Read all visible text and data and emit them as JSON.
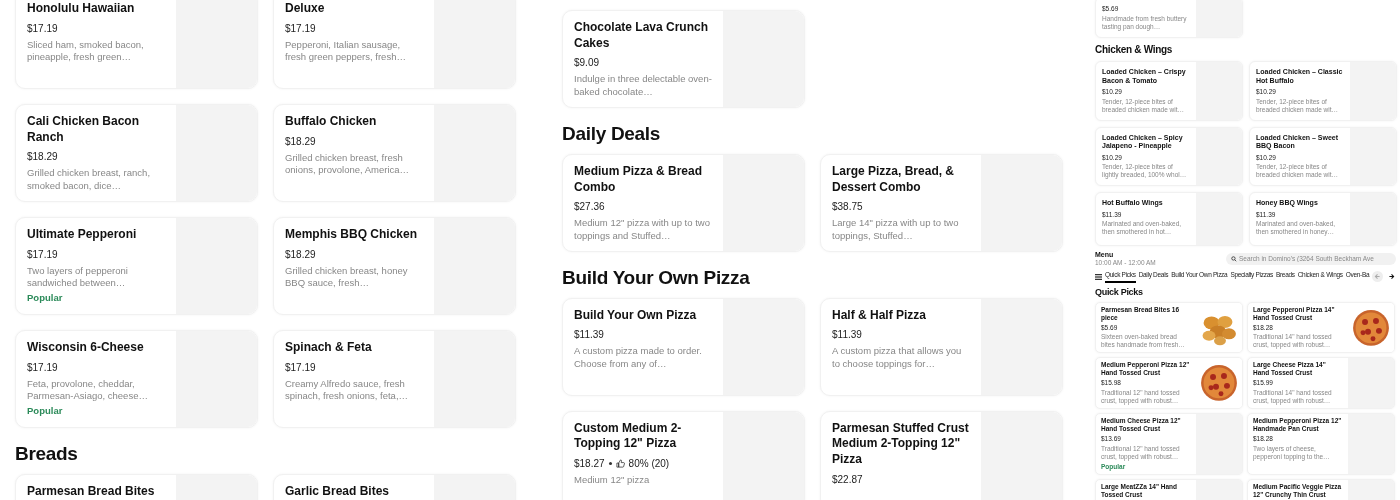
{
  "screens": [
    {
      "blocks": [
        {
          "kind": "cards",
          "cards": [
            {
              "name": "Honolulu Hawaiian",
              "price": "$17.19",
              "description": "Sliced ham, smoked bacon, pineapple, fresh green…",
              "photo": false
            },
            {
              "name": "Deluxe",
              "price": "$17.19",
              "description": "Pepperoni, Italian sausage, fresh green peppers, fresh…",
              "photo": false
            },
            {
              "name": "Cali Chicken Bacon Ranch",
              "price": "$18.29",
              "description": "Grilled chicken breast, ranch, smoked bacon, dice…",
              "photo": false
            },
            {
              "name": "Buffalo Chicken",
              "price": "$18.29",
              "description": "Grilled chicken breast, fresh onions, provolone, America…",
              "photo": false
            },
            {
              "name": "Ultimate Pepperoni",
              "price": "$17.19",
              "description": "Two layers of pepperoni sandwiched between…",
              "badge": "Popular",
              "photo": false
            },
            {
              "name": "Memphis BBQ Chicken",
              "price": "$18.29",
              "description": "Grilled chicken breast, honey BBQ sauce, fresh…",
              "photo": false
            },
            {
              "name": "Wisconsin 6-Cheese",
              "price": "$17.19",
              "description": "Feta, provolone, cheddar, Parmesan-Asiago, cheese…",
              "badge": "Popular",
              "photo": false
            },
            {
              "name": "Spinach & Feta",
              "price": "$17.19",
              "description": "Creamy Alfredo sauce, fresh spinach, fresh onions, feta,…",
              "photo": false
            }
          ]
        },
        {
          "kind": "heading",
          "text": "Breads"
        },
        {
          "kind": "cards",
          "cards": [
            {
              "name": "Parmesan Bread Bites",
              "photo": false
            },
            {
              "name": "Garlic Bread Bites",
              "photo": false
            }
          ]
        }
      ]
    },
    {
      "blocks": [
        {
          "kind": "cards",
          "cards": [
            {
              "name": "Chocolate Lava Crunch Cakes",
              "price": "$9.09",
              "description": "Indulge in three delectable oven-baked chocolate…",
              "photo": false
            }
          ]
        },
        {
          "kind": "heading",
          "text": "Daily Deals"
        },
        {
          "kind": "cards",
          "cards": [
            {
              "name": "Medium Pizza & Bread Combo",
              "price": "$27.36",
              "description": "Medium 12\" pizza with up to two toppings and Stuffed…",
              "photo": false
            },
            {
              "name": "Large Pizza, Bread, & Dessert Combo",
              "price": "$38.75",
              "description": "Large 14\" pizza with up to two toppings, Stuffed…",
              "photo": false
            }
          ]
        },
        {
          "kind": "heading",
          "text": "Build Your Own Pizza"
        },
        {
          "kind": "cards",
          "cards": [
            {
              "name": "Build Your Own Pizza",
              "price": "$11.39",
              "description": "A custom pizza made to order. Choose from any of…",
              "photo": false
            },
            {
              "name": "Half & Half Pizza",
              "price": "$11.39",
              "description": "A custom pizza that allows you to choose toppings for…",
              "photo": false
            },
            {
              "name": "Custom Medium 2-Topping 12\" Pizza",
              "price": "$18.27",
              "rating": "80% (20)",
              "description": "Medium 12\" pizza",
              "photo": false
            },
            {
              "name": "Parmesan Stuffed Crust Medium 2-Topping 12\" Pizza",
              "price": "$22.87",
              "photo": false
            }
          ]
        }
      ]
    },
    {
      "blocks": [
        {
          "kind": "cards",
          "cards": [
            {
              "price": "$5.69",
              "description": "Handmade from fresh buttery tasting pan dough…",
              "photo": false
            }
          ]
        },
        {
          "kind": "heading",
          "text": "Chicken & Wings"
        },
        {
          "kind": "cards",
          "cards": [
            {
              "name": "Loaded Chicken – Crispy Bacon & Tomato",
              "price": "$10.29",
              "description": "Tender, 12-piece bites of breaded chicken made wit…",
              "photo": false
            },
            {
              "name": "Loaded Chicken – Classic Hot Buffalo",
              "price": "$10.29",
              "description": "Tender, 12-piece bites of breaded chicken made wit…",
              "photo": false
            },
            {
              "name": "Loaded Chicken – Spicy Jalapeno - Pineapple",
              "price": "$10.29",
              "description": "Tender, 12-piece bites of lightly breaded, 100% whol…",
              "photo": false
            },
            {
              "name": "Loaded Chicken – Sweet BBQ Bacon",
              "price": "$10.29",
              "description": "Tender, 12-piece bites of breaded chicken made wit…",
              "photo": false
            },
            {
              "name": "Hot Buffalo Wings",
              "price": "$11.39",
              "description": "Marinated and oven-baked, then smothered in hot…",
              "photo": false
            },
            {
              "name": "Honey BBQ Wings",
              "price": "$11.39",
              "description": "Marinated and oven-baked, then smothered in honey…",
              "photo": false
            }
          ]
        }
      ]
    },
    {
      "blocks": [
        {
          "kind": "header",
          "title": "Menu",
          "hours": "10:00 AM - 12:00 AM",
          "search": {
            "placeholder": "Search in Domino's (3264 South Beckham Ave"
          },
          "tabs": [
            {
              "label": "Quick Picks",
              "selected": true
            },
            {
              "label": "Daily Deals",
              "selected": false
            },
            {
              "label": "Build Your Own Pizza",
              "selected": false
            },
            {
              "label": "Specialty Pizzas",
              "selected": false
            },
            {
              "label": "Breads",
              "selected": false
            },
            {
              "label": "Chicken & Wings",
              "selected": false
            },
            {
              "label": "Oven-Ba",
              "selected": false
            }
          ]
        },
        {
          "kind": "heading",
          "text": "Quick Picks"
        },
        {
          "kind": "cards",
          "cards": [
            {
              "name": "Parmesan Bread Bites 16 piece",
              "price": "$5.69",
              "description": "Sixteen oven-baked bread bites handmade from fresh…",
              "photo": true
            },
            {
              "name": "Large Pepperoni Pizza 14\" Hand Tossed Crust",
              "price": "$18.28",
              "description": "Traditional 14\" hand tossed crust, topped with robust…",
              "photo": true
            },
            {
              "name": "Medium Pepperoni Pizza 12\" Hand Tossed Crust",
              "price": "$15.98",
              "description": "Traditional 12\" hand tossed crust, topped with robust…",
              "photo": true
            },
            {
              "name": "Large Cheese Pizza 14\" Hand Tossed Crust",
              "price": "$15.99",
              "description": "Traditional 14\" hand tossed crust, topped with robust…",
              "photo": false
            },
            {
              "name": "Medium Cheese Pizza 12\" Hand Tossed Crust",
              "price": "$13.69",
              "description": "Traditional 12\" hand tossed crust, topped with robust…",
              "badge": "Popular",
              "photo": false
            },
            {
              "name": "Medium Pepperoni Pizza 12\" Handmade Pan Crust",
              "price": "$18.28",
              "description": "Two layers of cheese, pepperoni topping to the…",
              "photo": false
            },
            {
              "name": "Large MeatZZa 14\" Hand Tossed Crust",
              "photo": false
            },
            {
              "name": "Medium Pacific Veggie Pizza 12\" Crunchy Thin Crust",
              "photo": false
            }
          ]
        }
      ]
    }
  ]
}
